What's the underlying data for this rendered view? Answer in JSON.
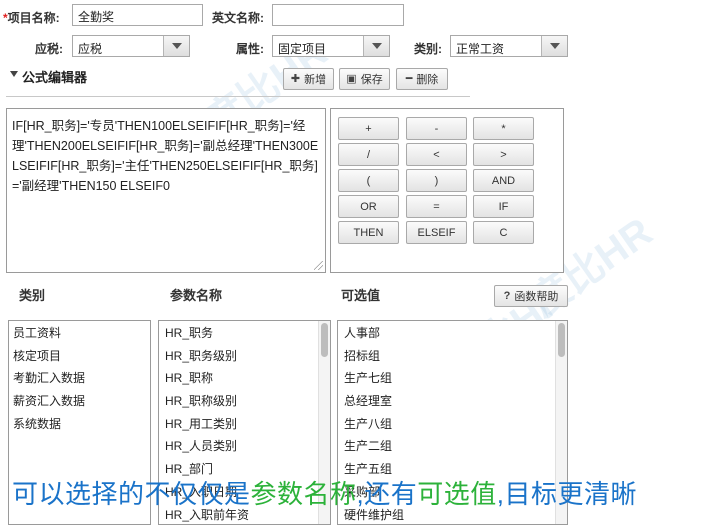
{
  "form": {
    "item_name_label": "项目名称:",
    "item_name_value": "全勤奖",
    "english_name_label": "英文名称:",
    "english_name_value": "",
    "tax_label": "应税:",
    "tax_value": "应税",
    "attribute_label": "属性:",
    "attribute_value": "固定项目",
    "category_label": "类别:",
    "category_value": "正常工资"
  },
  "editor": {
    "title": "公式编辑器",
    "new_label": "新增",
    "save_label": "保存",
    "delete_label": "删除",
    "formula": "IF[HR_职务]='专员'THEN100ELSEIFIF[HR_职务]='经理'THEN200ELSEIFIF[HR_职务]='副总经理'THEN300ELSEIFIF[HR_职务]='主任'THEN250ELSEIFIF[HR_职务]='副经理'THEN150 ELSEIF0"
  },
  "keypad": [
    "+",
    "-",
    "*",
    "/",
    "<",
    ">",
    "(",
    ")",
    "AND",
    "OR",
    "=",
    "IF",
    "THEN",
    "ELSEIF",
    "C"
  ],
  "columns": {
    "category": "类别",
    "param_name": "参数名称",
    "options": "可选值",
    "help_label": "函数帮助"
  },
  "category_list": [
    "员工资料",
    "核定项目",
    "考勤汇入数据",
    "薪资汇入数据",
    "系统数据"
  ],
  "param_list": [
    "HR_职务",
    "HR_职务级别",
    "HR_职称",
    "HR_职称级别",
    "HR_用工类别",
    "HR_人员类别",
    "HR_部门",
    "HR_入职日期",
    "HR_入职前年资"
  ],
  "option_list": [
    "人事部",
    "招标组",
    "生产七组",
    "总经理室",
    "生产八组",
    "生产二组",
    "生产五组",
    "采购部",
    "硬件维护组"
  ],
  "caption": {
    "part1": "可以选择的不仅仅是",
    "part2": "参数名称",
    "part3": ",还有",
    "part4": "可选值",
    "part5": ",目标更清晰"
  },
  "watermark": "度比HR",
  "colors": {
    "required": "#e02020",
    "caption_blue": "#1a73c9",
    "caption_green": "#2cb23a"
  }
}
